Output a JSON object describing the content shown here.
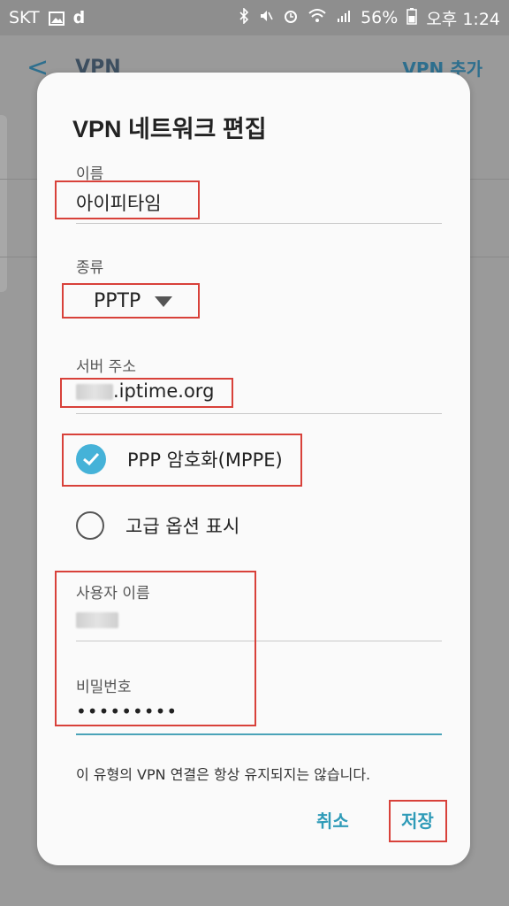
{
  "status_bar": {
    "carrier": "SKT",
    "app_letter": "d",
    "battery": "56%",
    "time": "오후 1:24"
  },
  "background": {
    "title": "VPN",
    "add_label": "VPN 추가"
  },
  "dialog": {
    "title": "VPN 네트워크 편집",
    "name": {
      "label": "이름",
      "value": "아이피타임"
    },
    "type": {
      "label": "종류",
      "value": "PPTP"
    },
    "server": {
      "label": "서버 주소",
      "value_suffix": ".iptime.org"
    },
    "ppp_encryption": {
      "label": "PPP 암호화(MPPE)",
      "checked": true
    },
    "advanced": {
      "label": "고급 옵션 표시",
      "checked": false
    },
    "username": {
      "label": "사용자 이름"
    },
    "password": {
      "label": "비밀번호",
      "masked": "•••••••••"
    },
    "note": "이 유형의 VPN 연결은 항상 유지되지는 않습니다.",
    "cancel_label": "취소",
    "save_label": "저장"
  },
  "colors": {
    "accent": "#45b2d8",
    "button_text": "#2f9bb8",
    "highlight_box": "#d8413a"
  }
}
